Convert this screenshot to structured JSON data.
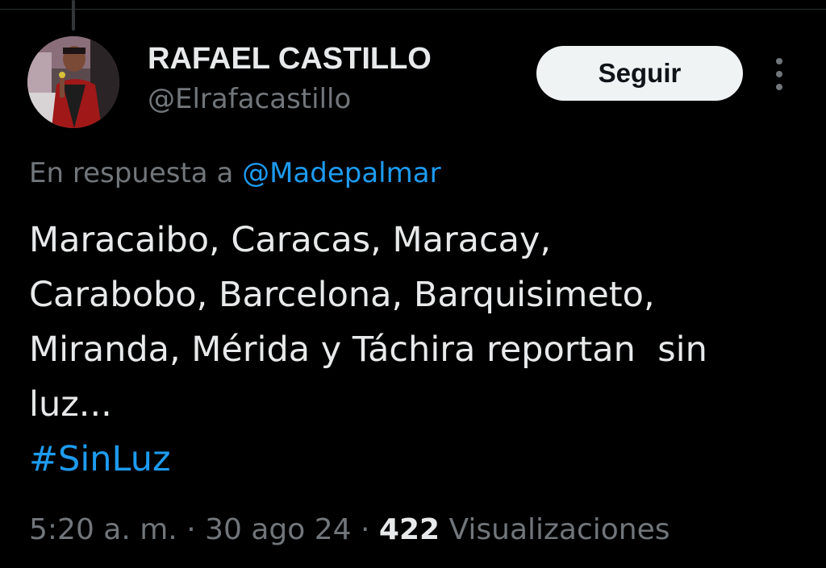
{
  "tweet": {
    "author": {
      "display_name": "RAFAEL CASTILLO",
      "handle": "@Elrafacastillo"
    },
    "follow_label": "Seguir",
    "more_icon": "more-vertical-icon",
    "reply": {
      "prefix": "En respuesta a",
      "mention": "@Madepalmar"
    },
    "text_lines": [
      "Maracaibo, Caracas, Maracay,",
      "Carabobo, Barcelona, Barquisimeto,",
      "Miranda, Mérida y Táchira reportan  sin",
      "luz..."
    ],
    "hashtag": "#SinLuz",
    "time": "5:20 a. m.",
    "separator": "·",
    "date": "30 ago 24",
    "views_count": "422",
    "views_label": "Visualizaciones"
  },
  "colors": {
    "background": "#000000",
    "text_primary": "#e7e9ea",
    "text_secondary": "#71767b",
    "link": "#1d9bf0",
    "button_bg": "#eff3f4",
    "button_text": "#0f1419"
  }
}
